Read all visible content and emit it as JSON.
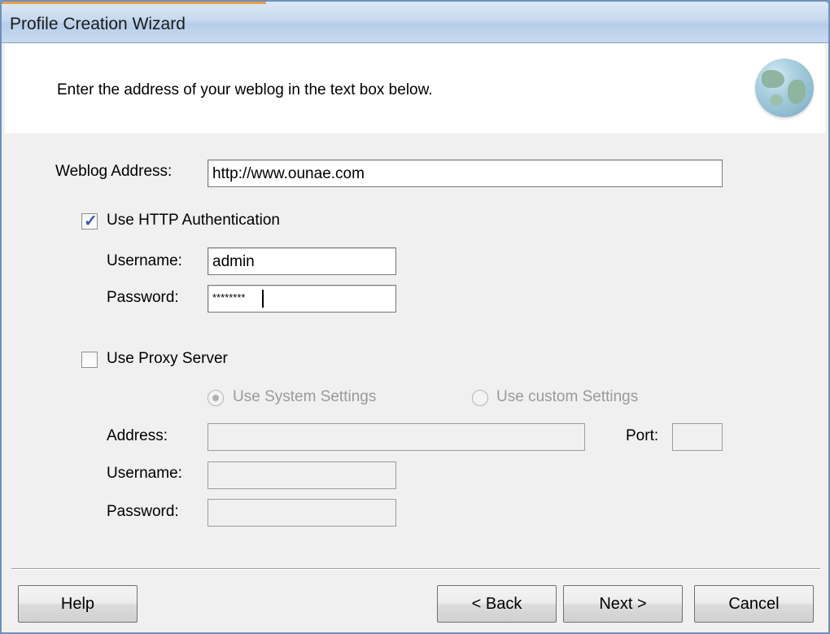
{
  "window": {
    "title": "Profile Creation Wizard"
  },
  "header": {
    "instruction": "Enter the address of your weblog in the text box below."
  },
  "weblog": {
    "label": "Weblog Address:",
    "value": "http://www.ounae.com"
  },
  "http_auth": {
    "checkbox_label": "Use HTTP Authentication",
    "checked": true,
    "username_label": "Username:",
    "username_value": "admin",
    "password_label": "Password:",
    "password_value": "********"
  },
  "proxy": {
    "checkbox_label": "Use Proxy Server",
    "checked": false,
    "radio_system_label": "Use System Settings",
    "radio_custom_label": "Use custom Settings",
    "address_label": "Address:",
    "port_label": "Port:",
    "username_label": "Username:",
    "password_label": "Password:",
    "address_value": "",
    "port_value": "",
    "username_value": "",
    "password_value": ""
  },
  "buttons": {
    "help": "Help",
    "back": "< Back",
    "next": "Next >",
    "cancel": "Cancel"
  },
  "icons": {
    "header_icon": "globe-icon",
    "http_auth_check": "checkmark-icon"
  }
}
